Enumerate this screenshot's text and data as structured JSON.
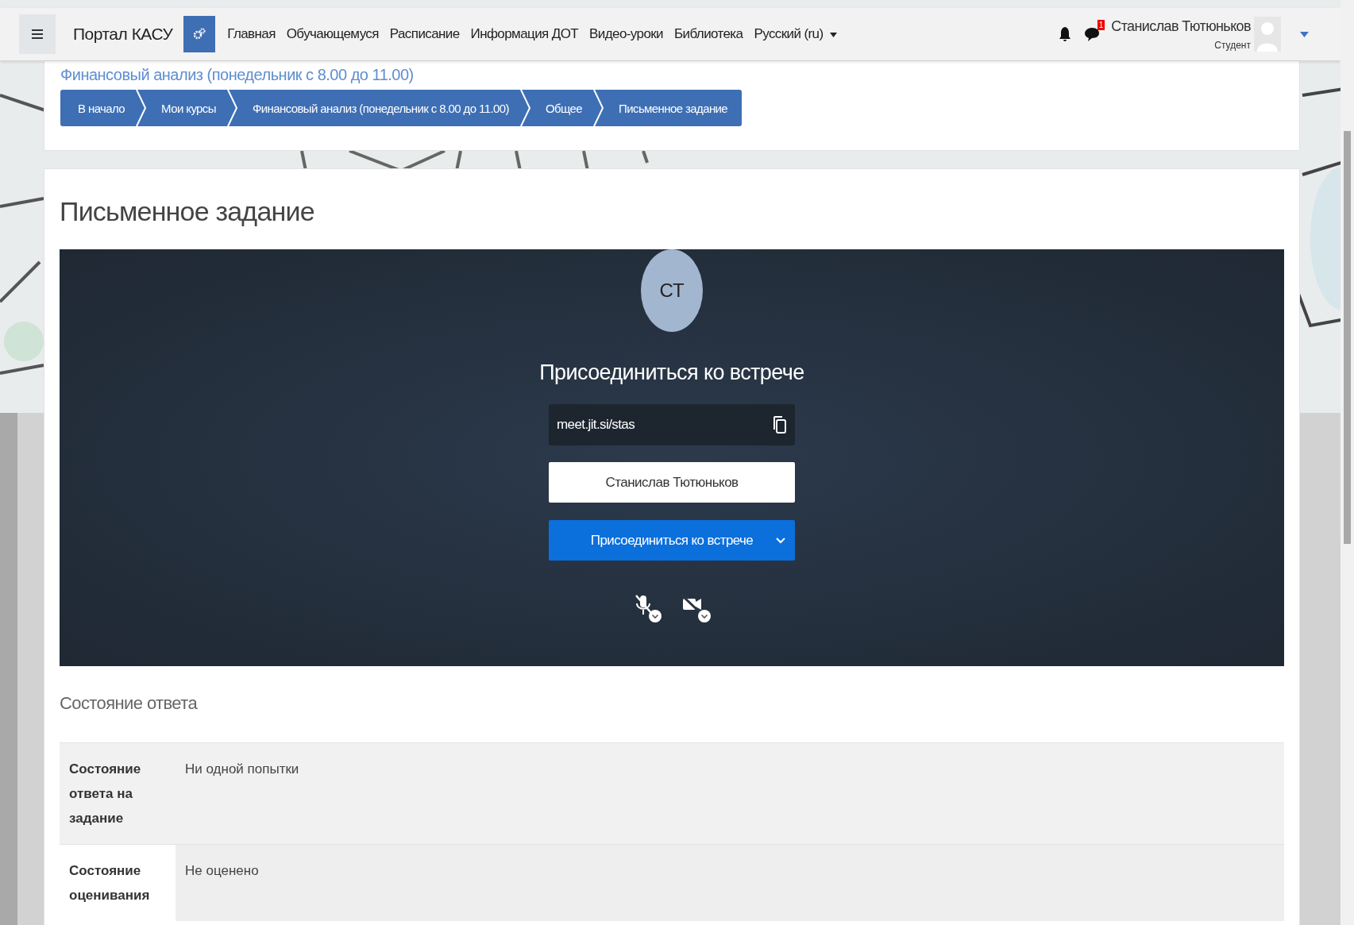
{
  "navbar": {
    "brand": "Портал КАСУ",
    "links": [
      "Главная",
      "Обучающемуся",
      "Расписание",
      "Информация ДОТ",
      "Видео-уроки",
      "Библиотека"
    ],
    "language": "Русский (ru)",
    "message_count": "1",
    "user_name": "Станислав Тютюньков",
    "user_role": "Студент"
  },
  "course_title": "Финансовый анализ (понедельник с 8.00 до 11.00)",
  "breadcrumbs": [
    "В начало",
    "Мои курсы",
    "Финансовый анализ (понедельник с 8.00 до 11.00)",
    "Общее",
    "Письменное задание"
  ],
  "page_title": "Письменное задание",
  "meeting": {
    "avatar_initials": "СТ",
    "heading": "Присоединиться ко встрече",
    "url": "meet.jit.si/stas",
    "name_value": "Станислав Тютюньков",
    "join_button": "Присоединиться ко встрече",
    "mic_muted": true,
    "camera_off": true
  },
  "section_title": "Состояние ответа",
  "status_rows": [
    {
      "label": "Состояние ответа на задание",
      "value": "Ни одной попытки"
    },
    {
      "label": "Состояние оценивания",
      "value": "Не оценено"
    }
  ]
}
